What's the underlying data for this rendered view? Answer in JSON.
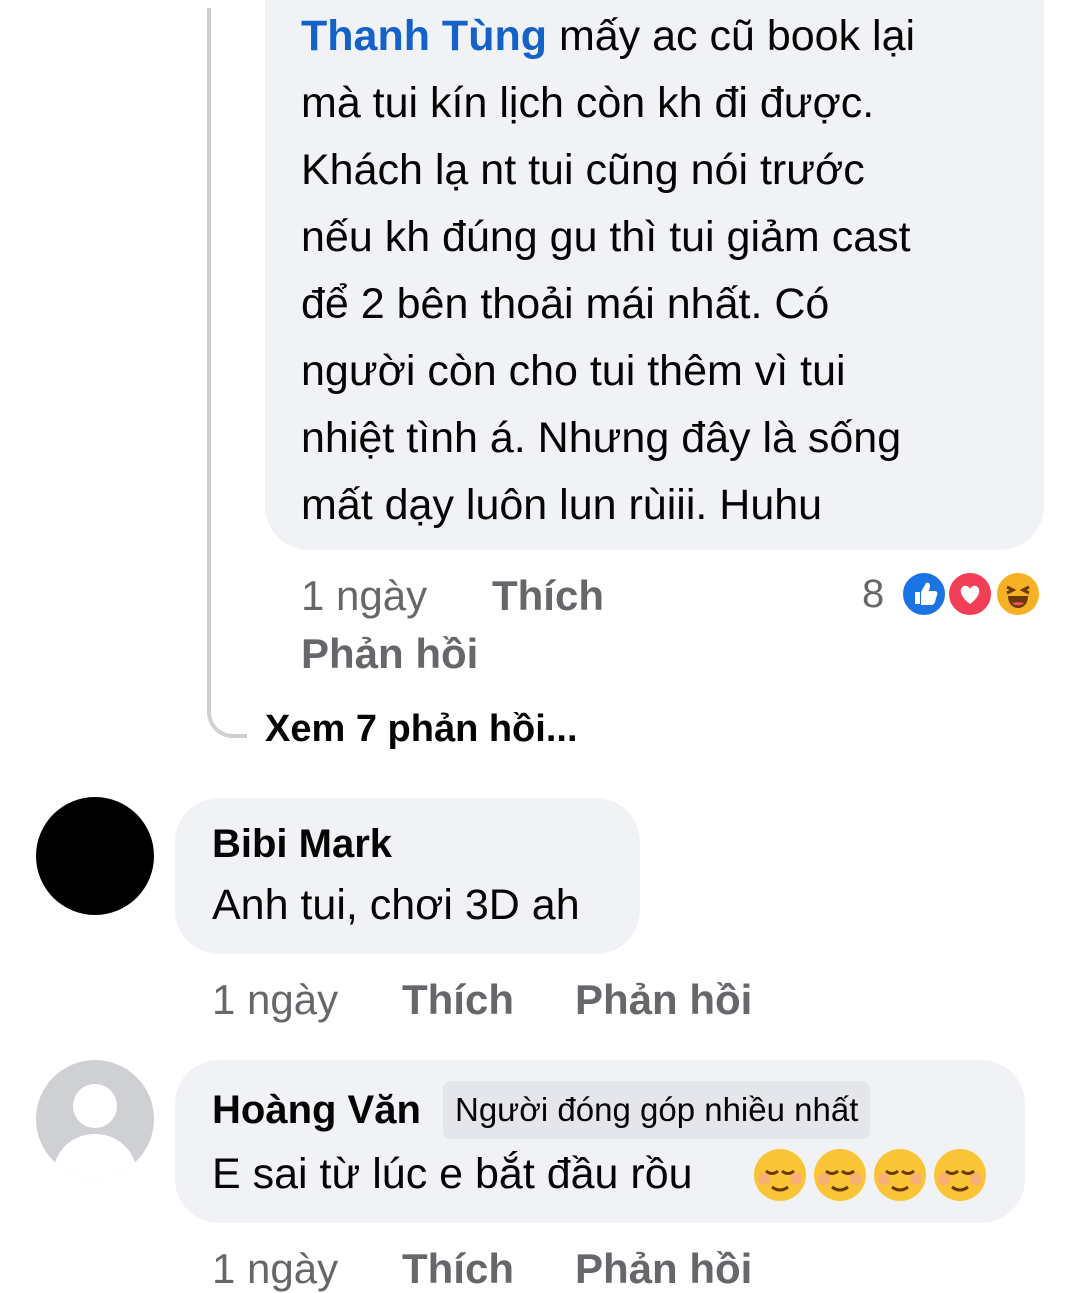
{
  "reply": {
    "mention": "Thanh Tùng",
    "lines": [
      " mấy ac cũ book lại",
      "mà tui kín lịch còn kh đi được.",
      "Khách lạ nt tui cũng nói trước",
      "nếu kh đúng gu thì tui giảm cast",
      "để 2 bên thoải mái nhất. Có",
      "người còn cho tui thêm vì tui",
      "nhiệt tình á. Nhưng đây là sống",
      "mất dạy luôn lun rùiii. Huhu"
    ],
    "time": "1 ngày",
    "like_label": "Thích",
    "reply_label": "Phản hồi",
    "reaction_count": "8",
    "reactions": [
      "like-icon",
      "love-icon",
      "haha-icon"
    ]
  },
  "view_more_replies": "Xem 7 phản hồi...",
  "comments": [
    {
      "author": "Bibi Mark",
      "text": "Anh tui, chơi 3D ah",
      "time": "1 ngày",
      "like_label": "Thích",
      "reply_label": "Phản hồi"
    },
    {
      "author": "Hoàng Văn",
      "badge": "Người đóng góp nhiều nhất",
      "text": "E sai từ lúc e bắt đầu rồu",
      "emojis": [
        "relieved-face-icon",
        "relieved-face-icon",
        "relieved-face-icon",
        "relieved-face-icon"
      ],
      "time": "1 ngày",
      "like_label": "Thích",
      "reply_label": "Phản hồi"
    }
  ],
  "colors": {
    "bubble": "#f0f2f5",
    "mention": "#1461c8",
    "meta": "#65676b",
    "like": "#1b74e4",
    "love": "#f33e58",
    "haha": "#f7b125"
  }
}
